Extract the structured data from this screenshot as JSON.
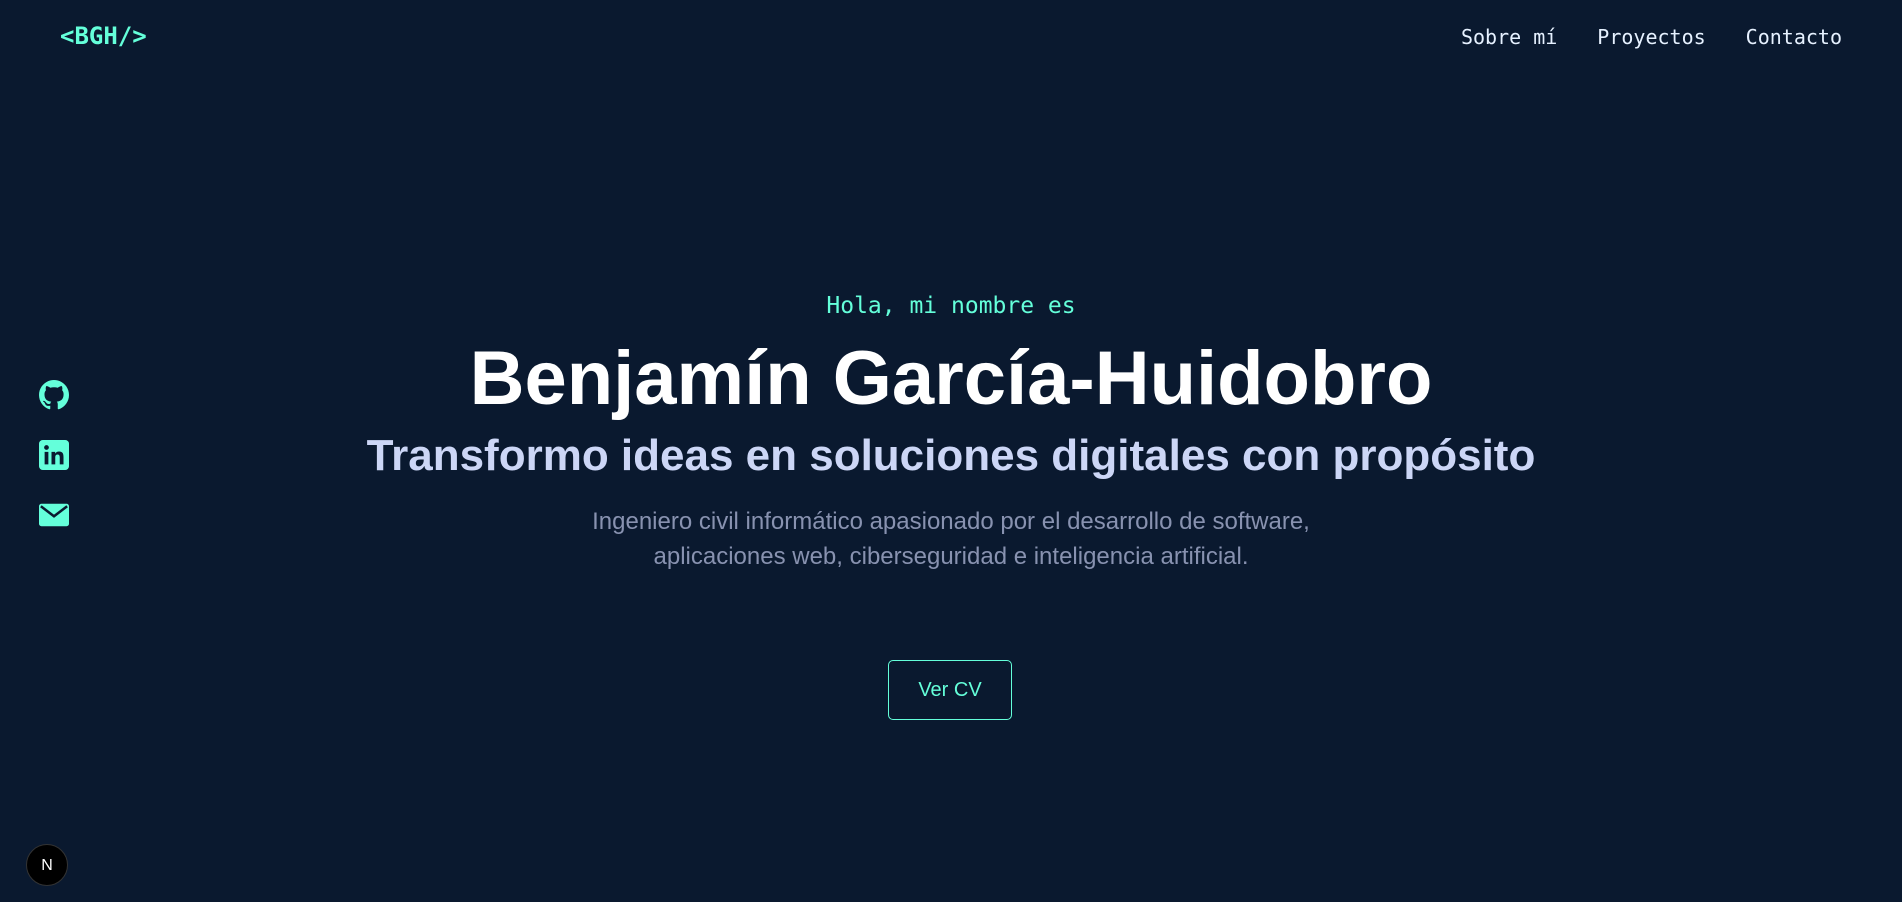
{
  "header": {
    "logo": "<BGH/>",
    "nav": [
      {
        "label": "Sobre mí"
      },
      {
        "label": "Proyectos"
      },
      {
        "label": "Contacto"
      }
    ]
  },
  "social": [
    {
      "icon": "github-icon"
    },
    {
      "icon": "linkedin-icon"
    },
    {
      "icon": "mail-icon"
    }
  ],
  "hero": {
    "greeting": "Hola, mi nombre es",
    "name": "Benjamín García-Huidobro",
    "tagline": "Transformo ideas en soluciones digitales con propósito",
    "description_line1": "Ingeniero civil informático apasionado por el desarrollo de software,",
    "description_line2": "aplicaciones web, ciberseguridad e inteligencia artificial.",
    "cta_label": "Ver CV"
  },
  "badge": {
    "letter": "N"
  },
  "colors": {
    "background": "#0a192f",
    "accent": "#64ffda",
    "heading": "#ffffff",
    "subheading": "#ccd6f6",
    "body_text": "#8892b0"
  }
}
